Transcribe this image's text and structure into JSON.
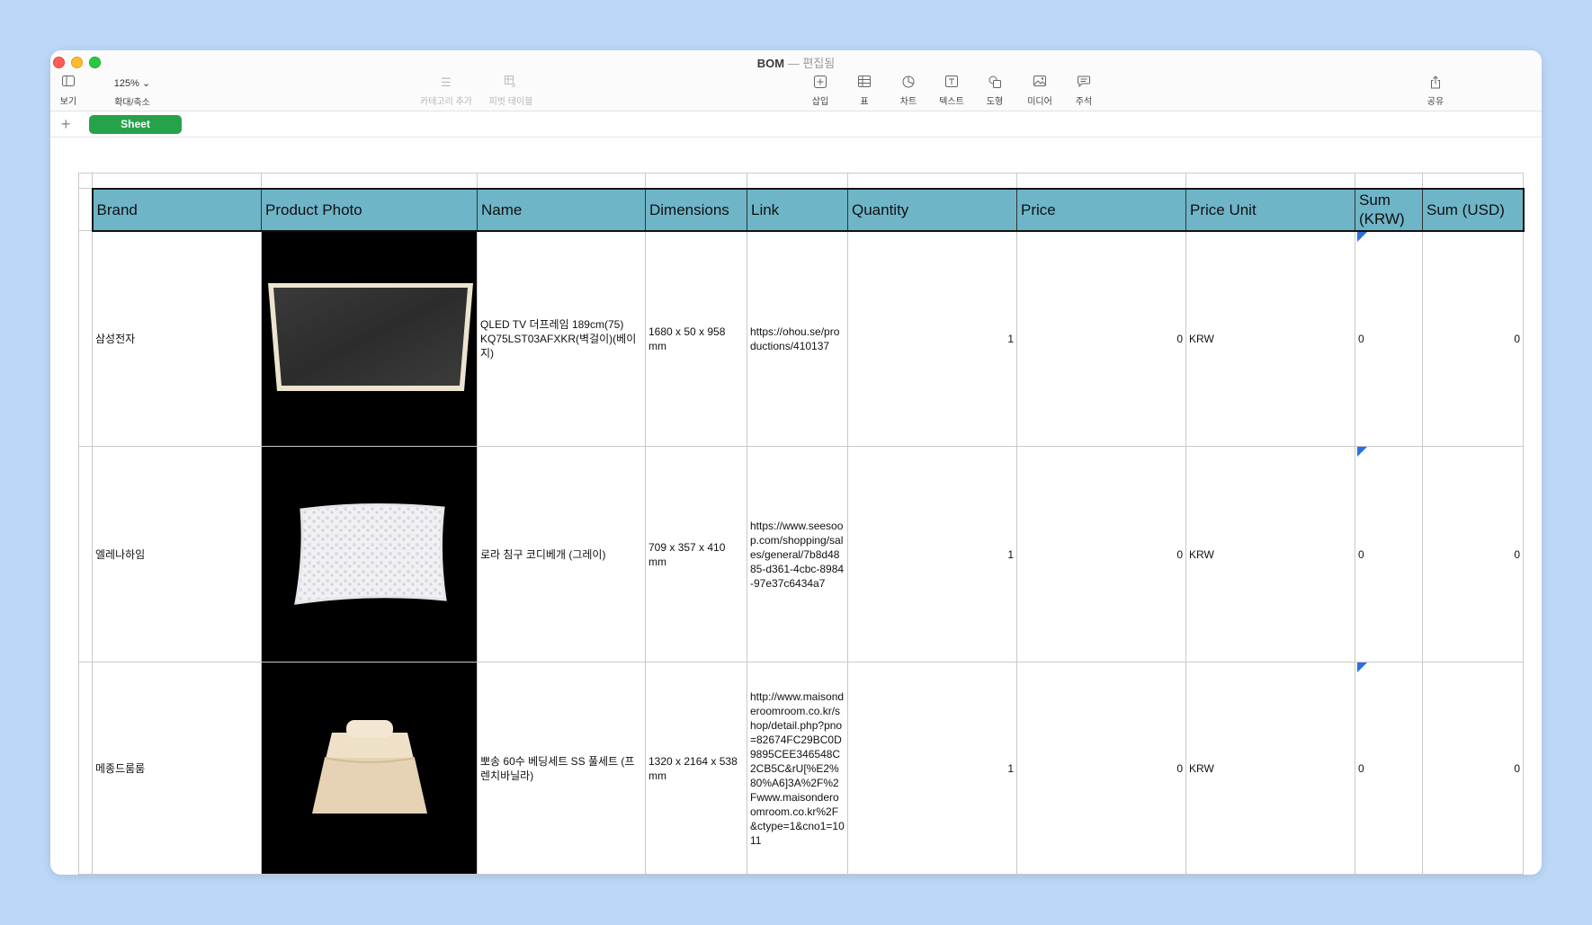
{
  "window": {
    "title": "BOM",
    "subtitle": "편집됨"
  },
  "toolbar": {
    "view_label": "보기",
    "zoom_value": "125%",
    "zoom_label": "확대/축소",
    "category_label": "카테고리 추가",
    "pivot_label": "피벗 테이블",
    "insert_label": "삽입",
    "table_label": "표",
    "chart_label": "차트",
    "text_label": "텍스트",
    "shape_label": "도형",
    "media_label": "미디어",
    "comment_label": "주석",
    "share_label": "공유"
  },
  "sheets": {
    "add_label": "+",
    "active_tab": "Sheet"
  },
  "table": {
    "headers": [
      "Brand",
      "Product Photo",
      "Name",
      "Dimensions",
      "Link",
      "Quantity",
      "Price",
      "Price Unit",
      "Sum (KRW)",
      "Sum (USD)"
    ],
    "rows": [
      {
        "brand": "삼성전자",
        "photo": "tv-icon",
        "name": "QLED TV 더프레임 189cm(75) KQ75LST03AFXKR(벽걸이)(베이지)",
        "dimensions": "1680 x 50 x 958 mm",
        "link": "https://ohou.se/productions/410137",
        "quantity": "1",
        "price": "0",
        "price_unit": "KRW",
        "sum_krw": "0",
        "sum_usd": "0"
      },
      {
        "brand": "엘레나하임",
        "photo": "pillow-icon",
        "name": "로라 침구 코디베개 (그레이)",
        "dimensions": "709 x 357 x 410 mm",
        "link": "https://www.seesoop.com/shopping/sales/general/7b8d4885-d361-4cbc-8984-97e37c6434a7",
        "quantity": "1",
        "price": "0",
        "price_unit": "KRW",
        "sum_krw": "0",
        "sum_usd": "0"
      },
      {
        "brand": "메종드룸룸",
        "photo": "bed-icon",
        "name": "뽀송 60수 베딩세트 SS 풀세트 (프렌치바닐라)",
        "dimensions": "1320 x 2164 x 538 mm",
        "link": "http://www.maisonderoomroom.co.kr/shop/detail.php?pno=82674FC29BC0D9895CEE346548C2CB5C&rU[%E2%80%A6]3A%2F%2Fwww.maisonderoomroom.co.kr%2F&ctype=1&cno1=1011",
        "quantity": "1",
        "price": "0",
        "price_unit": "KRW",
        "sum_krw": "0",
        "sum_usd": "0"
      }
    ]
  }
}
